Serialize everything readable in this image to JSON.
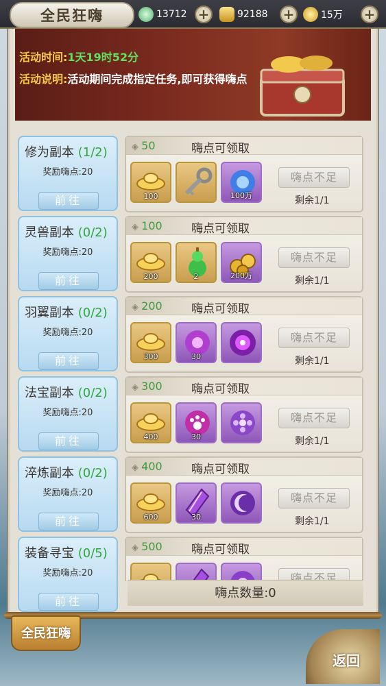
{
  "header": {
    "title": "全民狂嗨",
    "jade": "13712",
    "gold": "92188",
    "coins": "15万"
  },
  "banner": {
    "time_label": "活动时间:",
    "time_value": "1天19时52分",
    "desc_label": "活动说明:",
    "desc_value": "活动期间完成指定任务,即可获得嗨点"
  },
  "tasks": [
    {
      "name": "修为副本",
      "count": "(1/2)",
      "reward": "奖励嗨点:20",
      "button": "前往"
    },
    {
      "name": "灵兽副本",
      "count": "(0/2)",
      "reward": "奖励嗨点:20",
      "button": "前往"
    },
    {
      "name": "羽翼副本",
      "count": "(0/2)",
      "reward": "奖励嗨点:20",
      "button": "前往"
    },
    {
      "name": "法宝副本",
      "count": "(0/2)",
      "reward": "奖励嗨点:20",
      "button": "前往"
    },
    {
      "name": "淬炼副本",
      "count": "(0/2)",
      "reward": "奖励嗨点:20",
      "button": "前往"
    },
    {
      "name": "装备寻宝",
      "count": "(0/5)",
      "reward": "奖励嗨点:20",
      "button": "前往"
    }
  ],
  "tiers": [
    {
      "points": "50",
      "claim": "嗨点可领取",
      "items": [
        {
          "icon": "gold-ingot",
          "qty": "100"
        },
        {
          "icon": "key",
          "qty": ""
        },
        {
          "icon": "blue-orb",
          "qty": "100万"
        }
      ],
      "button": "嗨点不足",
      "remain": "剩余1/1"
    },
    {
      "points": "100",
      "claim": "嗨点可领取",
      "items": [
        {
          "icon": "gold-ingot",
          "qty": "200"
        },
        {
          "icon": "green-gourd",
          "qty": "2"
        },
        {
          "icon": "coins",
          "qty": "200万"
        }
      ],
      "button": "嗨点不足",
      "remain": "剩余1/1"
    },
    {
      "points": "200",
      "claim": "嗨点可领取",
      "items": [
        {
          "icon": "gold-ingot",
          "qty": "300"
        },
        {
          "icon": "purple-orb",
          "qty": "30"
        },
        {
          "icon": "purple-glow",
          "qty": ""
        }
      ],
      "button": "嗨点不足",
      "remain": "剩余1/1"
    },
    {
      "points": "300",
      "claim": "嗨点可领取",
      "items": [
        {
          "icon": "gold-ingot",
          "qty": "400"
        },
        {
          "icon": "paw-orb",
          "qty": "30"
        },
        {
          "icon": "flower-orb",
          "qty": ""
        }
      ],
      "button": "嗨点不足",
      "remain": "剩余1/1"
    },
    {
      "points": "400",
      "claim": "嗨点可领取",
      "items": [
        {
          "icon": "gold-ingot",
          "qty": "600"
        },
        {
          "icon": "purple-crystal",
          "qty": "30"
        },
        {
          "icon": "moon-orb",
          "qty": ""
        }
      ],
      "button": "嗨点不足",
      "remain": "剩余1/1"
    },
    {
      "points": "500",
      "claim": "嗨点可领取",
      "items": [
        {
          "icon": "gold-ingot",
          "qty": ""
        },
        {
          "icon": "purple-crystal",
          "qty": ""
        },
        {
          "icon": "purple-orb",
          "qty": ""
        }
      ],
      "button": "嗨点不足",
      "remain": ""
    }
  ],
  "footer": {
    "points_label": "嗨点数量:0"
  },
  "bottom": {
    "tab_label": "全民狂嗨",
    "back_label": "返回"
  },
  "colors": {
    "green": "#2fa83a",
    "gold": "#f2c94c",
    "accent": "#b9802f"
  }
}
